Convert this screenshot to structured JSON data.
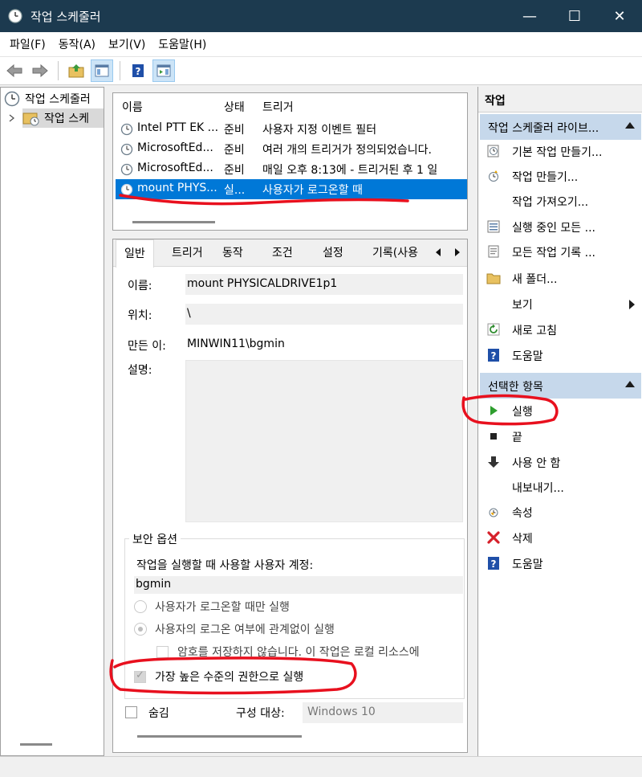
{
  "window": {
    "title": "작업 스케줄러",
    "minimize": "—",
    "maximize": "☐",
    "close": "✕"
  },
  "menu": [
    "파일(F)",
    "동작(A)",
    "보기(V)",
    "도움말(H)"
  ],
  "tree": {
    "root": "작업 스케줄러",
    "child": "작업 스케"
  },
  "task_list": {
    "headers": {
      "name": "이름",
      "status": "상태",
      "triggers": "트리거"
    },
    "rows": [
      {
        "name": "Intel PTT EK ...",
        "status": "준비",
        "triggers": "사용자 지정 이벤트 필터"
      },
      {
        "name": "MicrosoftEd...",
        "status": "준비",
        "triggers": "여러 개의 트리거가 정의되었습니다."
      },
      {
        "name": "MicrosoftEd...",
        "status": "준비",
        "triggers": "매일 오후 8:13에 - 트리거된 후 1 일"
      },
      {
        "name": "mount PHYS...",
        "status": "실...",
        "triggers": "사용자가 로그온할 때"
      }
    ]
  },
  "tabs": [
    "일반",
    "트리거",
    "동작",
    "조건",
    "설정",
    "기록(사용"
  ],
  "general": {
    "name_label": "이름:",
    "name_value": "mount PHYSICALDRIVE1p1",
    "location_label": "위치:",
    "location_value": "\\",
    "author_label": "만든 이:",
    "author_value": "MINWIN11\\bgmin",
    "description_label": "설명:",
    "security_group": "보안 옵션",
    "account_label": "작업을 실행할 때 사용할 사용자 계정:",
    "account_value": "bgmin",
    "radio_logged_on": "사용자가 로그온할 때만 실행",
    "radio_any": "사용자의 로그온 여부에 관계없이 실행",
    "no_password": "암호를 저장하지 않습니다. 이 작업은 로컬 리소스에",
    "highest_priv": "가장 높은 수준의 권한으로 실행",
    "hidden": "숨김",
    "configure_label": "구성 대상:",
    "configure_value": "Windows 10"
  },
  "actions": {
    "title": "작업",
    "library_section": "작업 스케줄러 라이브...",
    "library_items": [
      {
        "label": "기본 작업 만들기...",
        "icon": "basic-task-icon"
      },
      {
        "label": "작업 만들기...",
        "icon": "create-task-icon"
      },
      {
        "label": "작업 가져오기...",
        "icon": ""
      },
      {
        "label": "실행 중인 모든 ...",
        "icon": "running-tasks-icon"
      },
      {
        "label": "모든 작업 기록 ...",
        "icon": "history-icon"
      },
      {
        "label": "새 폴더...",
        "icon": "folder-icon"
      },
      {
        "label": "보기",
        "icon": ""
      },
      {
        "label": "새로 고침",
        "icon": "refresh-icon"
      },
      {
        "label": "도움말",
        "icon": "help-icon"
      }
    ],
    "selected_section": "선택한 항목",
    "selected_items": [
      {
        "label": "실행",
        "icon": "run-icon"
      },
      {
        "label": "끝",
        "icon": "end-icon"
      },
      {
        "label": "사용 안 함",
        "icon": "disable-icon"
      },
      {
        "label": "내보내기...",
        "icon": ""
      },
      {
        "label": "속성",
        "icon": "properties-icon"
      },
      {
        "label": "삭제",
        "icon": "delete-icon"
      },
      {
        "label": "도움말",
        "icon": "help-icon"
      }
    ]
  },
  "colors": {
    "titlebar": "#1c3a4f",
    "selection": "#0078d7",
    "section_header": "#c6d8eb",
    "annotation": "#e8101e"
  }
}
